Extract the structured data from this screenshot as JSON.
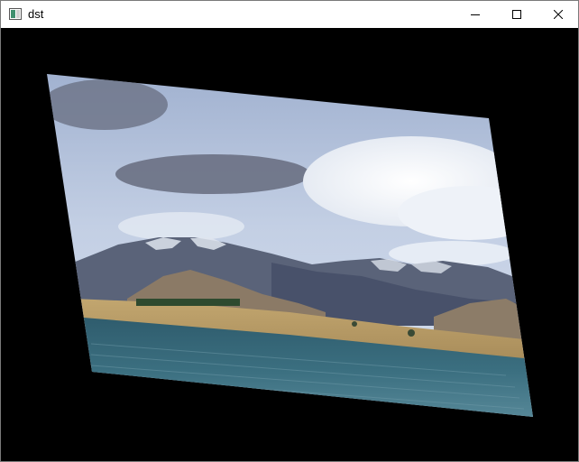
{
  "window": {
    "title": "dst",
    "app_icon": "opencv-window-icon",
    "controls": {
      "minimize_icon": "minimize-icon",
      "maximize_icon": "maximize-icon",
      "close_icon": "close-icon"
    }
  },
  "canvas": {
    "background": "#000000",
    "image_description_icon": "warped-landscape-image"
  },
  "colors": {
    "sky_top": "#a9b8d4",
    "sky_mid": "#c8d3e6",
    "cloud": "#f3f5f8",
    "dark_cloud": "#6d7284",
    "mountain": "#5b6478",
    "mountain_dark": "#3f4759",
    "snow": "#e8ecf2",
    "hill": "#8a7a68",
    "field": "#b79a6a",
    "water_top": "#3d6b7c",
    "water_bottom": "#4f8597"
  }
}
